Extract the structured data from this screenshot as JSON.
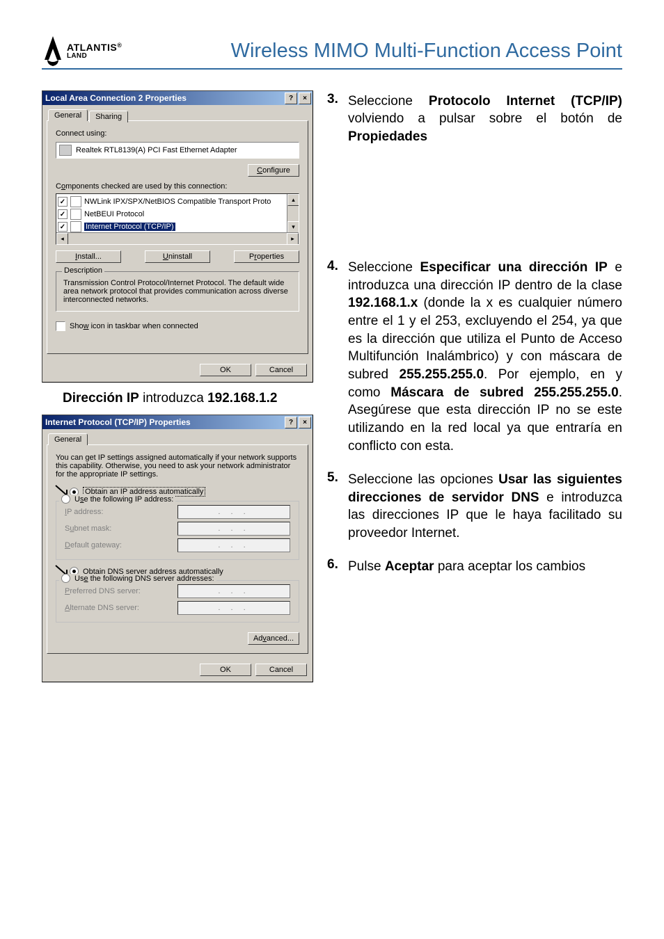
{
  "header": {
    "logo_main": "ATLANTIS",
    "logo_sub": "LAND",
    "logo_reg": "®",
    "page_title": "Wireless MIMO Multi-Function Access Point"
  },
  "dialog1": {
    "title": "Local Area Connection 2 Properties",
    "help_btn": "?",
    "close_btn": "×",
    "tab_general": "General",
    "tab_sharing": "Sharing",
    "connect_using_label": "Connect using:",
    "adapter": "Realtek RTL8139(A) PCI Fast Ethernet Adapter",
    "configure_btn": "Configure",
    "components_label": "Components checked are used by this connection:",
    "comp1": "NWLink IPX/SPX/NetBIOS Compatible Transport Proto",
    "comp2": "NetBEUI Protocol",
    "comp3": "Internet Protocol (TCP/IP)",
    "install_btn": "Install...",
    "uninstall_btn": "Uninstall",
    "properties_btn": "Properties",
    "desc_title": "Description",
    "desc_text": "Transmission Control Protocol/Internet Protocol. The default wide area network protocol that provides communication across diverse interconnected networks.",
    "show_icon": "Show icon in taskbar when connected",
    "ok": "OK",
    "cancel": "Cancel"
  },
  "bridge": {
    "pre_b1": "Dirección IP",
    "mid": " introduzca ",
    "b2": "192.168.1.2"
  },
  "dialog2": {
    "title": "Internet Protocol (TCP/IP) Properties",
    "help_btn": "?",
    "close_btn": "×",
    "tab_general": "General",
    "intro": "You can get IP settings assigned automatically if your network supports this capability. Otherwise, you need to ask your network administrator for the appropriate IP settings.",
    "opt_auto_ip": "Obtain an IP address automatically",
    "opt_use_ip": "Use the following IP address:",
    "ip_label": "IP address:",
    "subnet_label": "Subnet mask:",
    "gateway_label": "Default gateway:",
    "opt_auto_dns": "Obtain DNS server address automatically",
    "opt_use_dns": "Use the following DNS server addresses:",
    "pref_dns": "Preferred DNS server:",
    "alt_dns": "Alternate DNS server:",
    "advanced_btn": "Advanced...",
    "ok": "OK",
    "cancel": "Cancel",
    "dots": ".    .    ."
  },
  "steps": {
    "s3_num": "3.",
    "s3_a": "Seleccione ",
    "s3_b1": "Protocolo Internet (TCP/IP)",
    "s3_c": " volviendo a pulsar sobre el botón de ",
    "s3_b2": "Propiedades",
    "s4_num": "4.",
    "s4_a": "Seleccione ",
    "s4_b1": "Especificar una dirección IP",
    "s4_c": " e introduzca una dirección IP dentro de la clase ",
    "s4_b2": "192.168.1.x",
    "s4_d": " (donde la x es cualquier número entre el 1 y el 253, excluyendo el 254, ya que es la dirección que utiliza el Punto de Acceso Multifunción Inalámbrico) y con máscara de subred ",
    "s4_b3": "255.255.255.0",
    "s4_e": ". Por ejemplo, en y como ",
    "s4_b4": "Máscara de subred 255.255.255.0",
    "s4_f": ". Asegúrese que esta dirección IP no se este utilizando en la red local ya que entraría en conflicto con esta.",
    "s5_num": "5.",
    "s5_a": "Seleccione las opciones ",
    "s5_b1": "Usar las siguientes direcciones de servidor DNS",
    "s5_c": " e introduzca las direcciones IP que le haya facilitado su proveedor Internet.",
    "s6_num": "6.",
    "s6_a": "Pulse ",
    "s6_b1": "Aceptar",
    "s6_c": " para aceptar los cambios"
  }
}
